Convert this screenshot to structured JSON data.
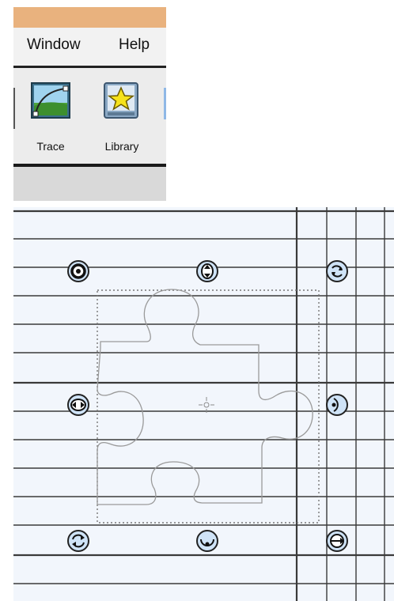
{
  "menubar": {
    "window_label": "Window",
    "help_label": "Help"
  },
  "toolbar": {
    "trace_label": "Trace",
    "library_label": "Library",
    "trace_icon": "trace-curve-icon",
    "library_icon": "star-book-icon"
  },
  "canvas": {
    "shape_name": "puzzle-piece-shape",
    "handle_icons": [
      "rotate-handle-icon",
      "scale-vertical-handle-icon",
      "rotate-handle-icon",
      "scale-horizontal-handle-icon",
      "scale-horizontal-handle-icon",
      "rotate-handle-icon",
      "scale-vertical-handle-icon",
      "scale-horizontal-handle-icon"
    ],
    "colors": {
      "background": "#f2f6fc",
      "grid_line": "#2b2b2b",
      "handle_fill": "#cfe3f7"
    }
  },
  "titlebar": {
    "color": "#e9b27e"
  }
}
